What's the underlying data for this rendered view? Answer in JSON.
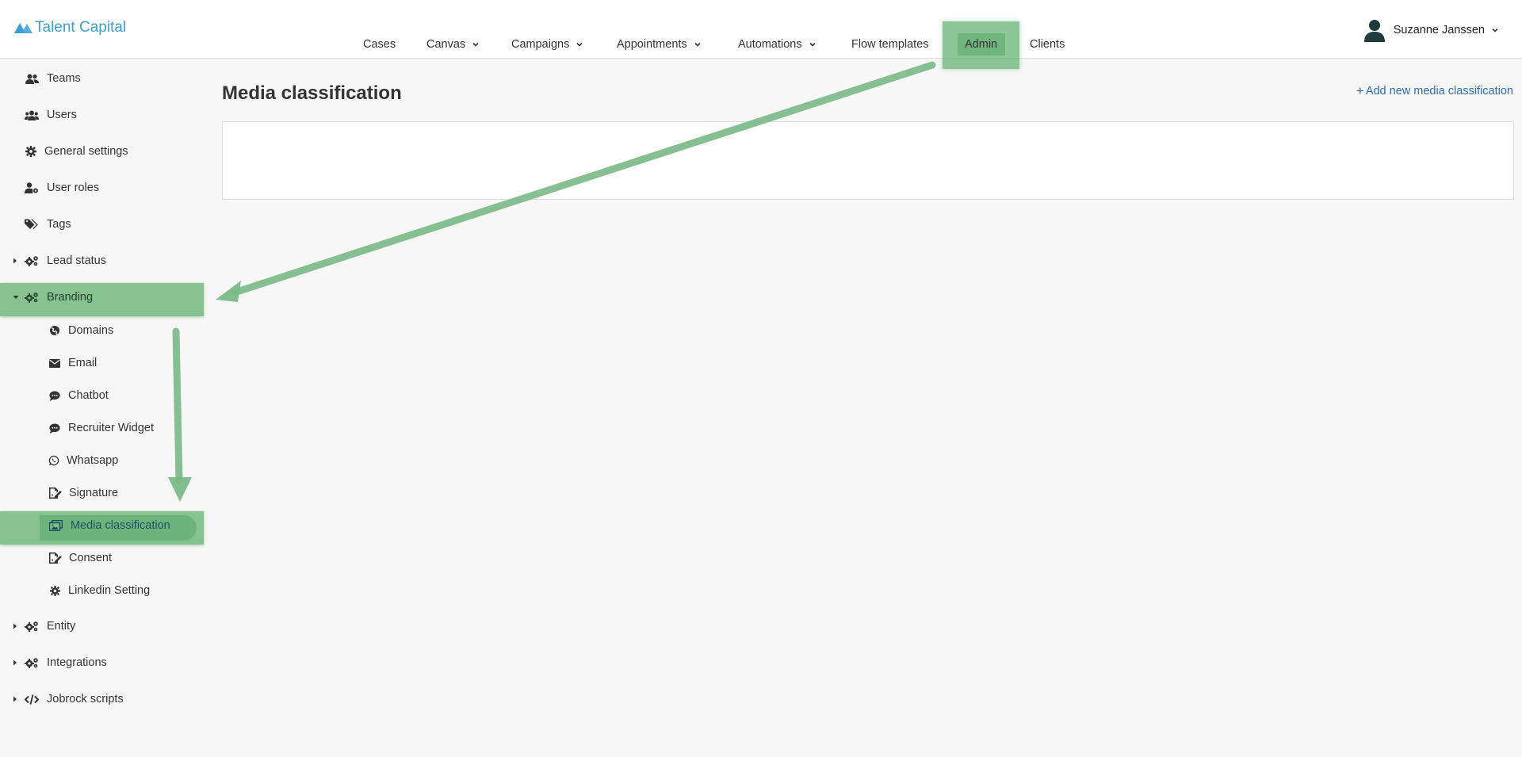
{
  "app": {
    "logo_text": "Talent Capital",
    "brand_color": "#3b9fd6",
    "highlight_color": "#5fb06e"
  },
  "nav": {
    "items": [
      {
        "label": "Cases",
        "icon": "",
        "dropdown": false
      },
      {
        "label": "Canvas",
        "dropdown": true
      },
      {
        "label": "Campaigns",
        "dropdown": true
      },
      {
        "label": "Appointments",
        "dropdown": true
      },
      {
        "label": "Automations",
        "dropdown": true
      },
      {
        "label": "Flow templates",
        "dropdown": false
      },
      {
        "label": "Admin",
        "dropdown": false,
        "active": true
      },
      {
        "label": "Clients",
        "dropdown": false
      }
    ]
  },
  "user": {
    "name": "Suzanne Janssen"
  },
  "sidebar": {
    "items": [
      {
        "label": "Teams",
        "icon": "users-icon"
      },
      {
        "label": "Users",
        "icon": "users-group-icon"
      },
      {
        "label": "General settings",
        "icon": "gear-icon"
      },
      {
        "label": "User roles",
        "icon": "user-cog-icon"
      },
      {
        "label": "Tags",
        "icon": "tags-icon"
      },
      {
        "label": "Lead status",
        "icon": "gears-icon",
        "expandable": true,
        "expanded": false
      },
      {
        "label": "Branding",
        "icon": "gears-icon",
        "expandable": true,
        "expanded": true,
        "highlighted": true
      },
      {
        "label": "Domains",
        "icon": "globe-icon",
        "child": true
      },
      {
        "label": "Email",
        "icon": "envelope-icon",
        "child": true
      },
      {
        "label": "Chatbot",
        "icon": "comment-icon",
        "child": true
      },
      {
        "label": "Recruiter Widget",
        "icon": "comment-icon",
        "child": true
      },
      {
        "label": "Whatsapp",
        "icon": "whatsapp-icon",
        "child": true
      },
      {
        "label": "Signature",
        "icon": "signature-icon",
        "child": true
      },
      {
        "label": "Media classification",
        "icon": "images-icon",
        "child": true,
        "active": true
      },
      {
        "label": "Consent",
        "icon": "signature-icon",
        "child": true
      },
      {
        "label": "Linkedin Setting",
        "icon": "gear-icon",
        "child": true
      },
      {
        "label": "Entity",
        "icon": "gears-icon",
        "expandable": true,
        "expanded": false
      },
      {
        "label": "Integrations",
        "icon": "gears-icon",
        "expandable": true,
        "expanded": false
      },
      {
        "label": "Jobrock scripts",
        "icon": "code-icon",
        "expandable": true,
        "expanded": false
      }
    ]
  },
  "main": {
    "title": "Media classification",
    "add_link": "Add new media classification"
  }
}
